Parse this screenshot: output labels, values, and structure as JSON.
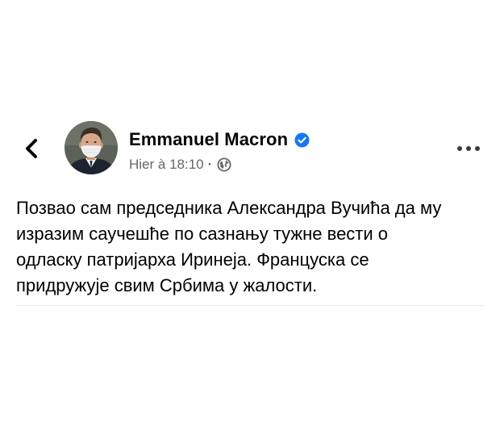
{
  "post": {
    "author": "Emmanuel Macron",
    "timestamp": "Hier à 18:10",
    "separator": "·",
    "text_lines": [
      "Позвао сам председника Александра Вучића да му",
      "изразим саучешће по сазнању тужне вести о",
      "одласку патријарха Иринеја. Француска се",
      "придружује свим Србима у жалости."
    ]
  },
  "icons": {
    "back": "chevron-left-icon",
    "verified": "verified-badge-icon",
    "audience": "globe-icon",
    "more": "more-options-icon"
  },
  "colors": {
    "verified_badge": "#1877F2",
    "timestamp": "#65676B",
    "divider": "#E4E6EB",
    "text": "#000000"
  }
}
